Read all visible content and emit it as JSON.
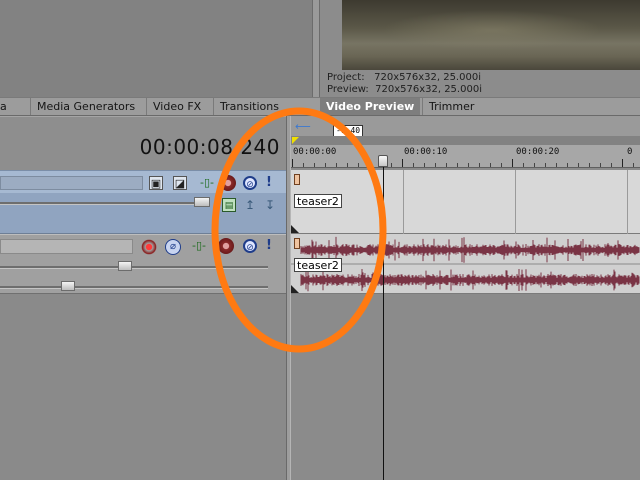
{
  "colors": {
    "annotation": "#ff7a12",
    "waveform": "#7a3445",
    "video_track": "#a6b9d2"
  },
  "preview": {
    "project_line": "Project:   720x576x32, 25.000i",
    "preview_line": "Preview:  720x576x32, 25.000i"
  },
  "tabs": [
    {
      "label": "a"
    },
    {
      "label": "Media Generators"
    },
    {
      "label": "Video FX"
    },
    {
      "label": "Transitions"
    },
    {
      "label": "Video Preview"
    },
    {
      "label": "Trimmer"
    }
  ],
  "timeline": {
    "timecode": "00:00:08.240",
    "marker_flag": "-1:40",
    "ruler_labels": [
      "00:00:00",
      "00:00:10",
      "00:00:20"
    ],
    "video_clip": "teaser2",
    "audio_clip": "teaser2"
  },
  "icons": {
    "video_track": [
      "composite-mode-icon",
      "compositing-child-icon",
      "motion-icon",
      "track-fx-icon",
      "mute-icon",
      "solo-icon"
    ],
    "video_track_row2": [
      "parent-composite-icon",
      "make-compositing-parent-icon",
      "make-compositing-child-icon"
    ],
    "audio_track": [
      "arm-record-icon",
      "invert-phase-icon",
      "motion-icon",
      "track-fx-icon",
      "mute-icon",
      "solo-icon"
    ]
  }
}
